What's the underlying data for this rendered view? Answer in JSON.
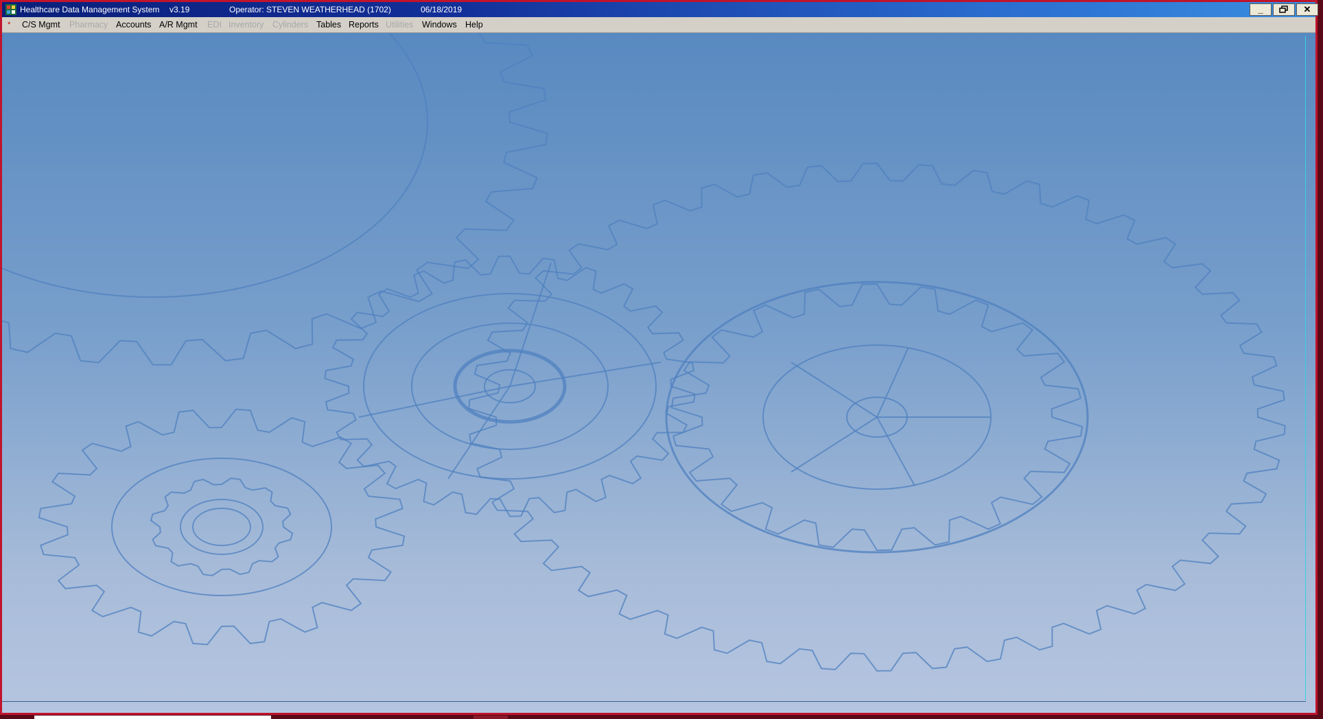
{
  "window": {
    "app_name": "Healthcare Data Management System",
    "version": "v3.19",
    "operator": "Operator: STEVEN WEATHERHEAD (1702)",
    "date": "06/18/2019",
    "controls": {
      "minimize": "_",
      "restore": "🗗",
      "close": "✕"
    }
  },
  "menubar": {
    "mdi_marker": "*",
    "items": [
      {
        "label": "C/S Mgmt",
        "enabled": true
      },
      {
        "label": "Pharmacy",
        "enabled": false
      },
      {
        "label": "Accounts",
        "enabled": true
      },
      {
        "label": "A/R Mgmt",
        "enabled": true
      },
      {
        "label": "EDI",
        "enabled": false
      },
      {
        "label": "Inventory",
        "enabled": false
      },
      {
        "label": "Cylinders",
        "enabled": false
      },
      {
        "label": "Tables",
        "enabled": true
      },
      {
        "label": "Reports",
        "enabled": true
      },
      {
        "label": "Utilities",
        "enabled": false
      },
      {
        "label": "Windows",
        "enabled": true
      },
      {
        "label": "Help",
        "enabled": true
      }
    ]
  },
  "background": {
    "icon": "gears-watermark",
    "gradient_top": "#5889c0",
    "gradient_bottom": "#b5c5e0",
    "gear_stroke": "#4f80bf"
  }
}
